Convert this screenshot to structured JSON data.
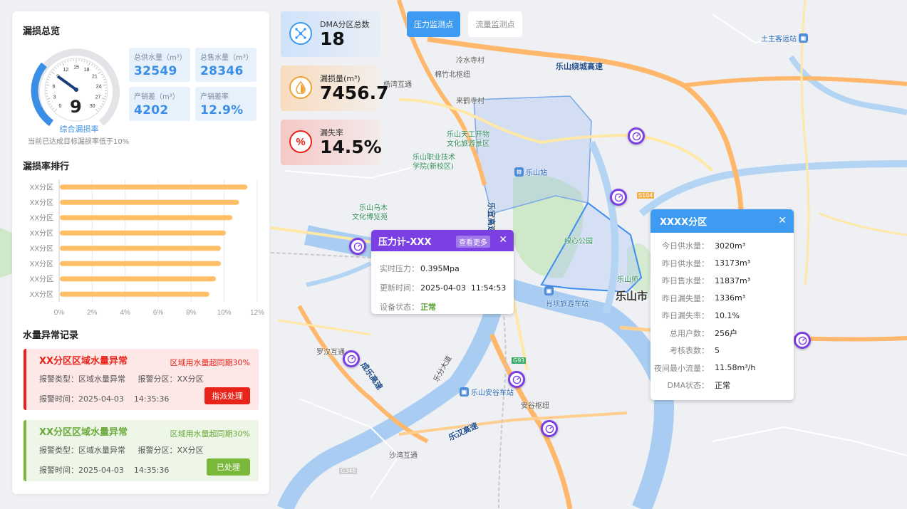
{
  "overview": {
    "title": "漏损总览",
    "gauge_value": "9",
    "gauge_ticks": [
      "0",
      "3",
      "6",
      "9",
      "12",
      "15",
      "18",
      "21",
      "24",
      "27",
      "30"
    ],
    "gauge_caption": "综合漏损率",
    "gauge_note": "当前已达成目标漏损率低于10%",
    "stats": [
      {
        "label": "总供水量（m³）",
        "value": "32549"
      },
      {
        "label": "总售水量（m³）",
        "value": "28346"
      },
      {
        "label": "产销差（m³）",
        "value": "4202"
      },
      {
        "label": "产销差率",
        "value": "12.9%"
      }
    ]
  },
  "ranking": {
    "title": "漏损率排行",
    "categories": [
      "XX分区",
      "XX分区",
      "XX分区",
      "XX分区",
      "XX分区",
      "XX分区",
      "XX分区",
      "XX分区"
    ],
    "x_ticks": [
      "0%",
      "2%",
      "4%",
      "6%",
      "8%",
      "10%",
      "12%"
    ]
  },
  "chart_data": {
    "type": "bar",
    "orientation": "horizontal",
    "categories": [
      "XX分区",
      "XX分区",
      "XX分区",
      "XX分区",
      "XX分区",
      "XX分区",
      "XX分区",
      "XX分区"
    ],
    "values": [
      11.4,
      10.9,
      10.5,
      10.1,
      9.8,
      9.8,
      9.5,
      9.1
    ],
    "xlim": [
      0,
      12
    ],
    "x_ticks": [
      "0%",
      "2%",
      "4%",
      "6%",
      "8%",
      "10%",
      "12%"
    ],
    "bar_color": "#ffbf66",
    "grid": true,
    "title": "漏损率排行"
  },
  "alerts": {
    "title": "水量异常记录",
    "items": [
      {
        "title": "XX分区区域水量异常",
        "tag": "区域用水量超同期30%",
        "type_label": "报警类型：",
        "type": "区域水量异常",
        "zone_label": "报警分区：",
        "zone": "XX分区",
        "time_label": "报警时间：",
        "time": "2025-04-03    14:35:36",
        "action": "指派处理",
        "status": "red"
      },
      {
        "title": "XX分区区域水量异常",
        "tag": "区域用水量超同期30%",
        "type_label": "报警类型：",
        "type": "区域水量异常",
        "zone_label": "报警分区：",
        "zone": "XX分区",
        "time_label": "报警时间：",
        "time": "2025-04-03    14:35:36",
        "action": "已处理",
        "status": "green"
      }
    ]
  },
  "kpis": [
    {
      "label": "DMA分区总数",
      "value": "18",
      "icon": "network-icon",
      "color": "#3d9bf2"
    },
    {
      "label": "漏损量(m³)",
      "value": "7456.7",
      "icon": "water-drop-icon",
      "color": "#f0a33a"
    },
    {
      "label": "漏失率",
      "value": "14.5%",
      "icon": "percent-icon",
      "color": "#e8231a"
    }
  ],
  "tabs": [
    {
      "label": "压力监测点",
      "active": true
    },
    {
      "label": "流量监测点",
      "active": false
    }
  ],
  "pressure_popup": {
    "title": "压力计-XXX",
    "more": "查看更多",
    "close": "✕",
    "rows": [
      {
        "label": "实时压力：",
        "value": "0.395Mpa"
      },
      {
        "label": "更新时间：",
        "value": "2025-04-03  11:54:53"
      },
      {
        "label": "设备状态：",
        "value": "正常"
      }
    ]
  },
  "zone_popup": {
    "title": "XXXX分区",
    "close": "✕",
    "rows": [
      {
        "label": "今日供水量：",
        "value": "3020m³"
      },
      {
        "label": "昨日供水量：",
        "value": "13173m³"
      },
      {
        "label": "昨日售水量：",
        "value": "11837m³"
      },
      {
        "label": "昨日漏失量：",
        "value": "1336m³"
      },
      {
        "label": "昨日漏失率：",
        "value": "10.1%"
      },
      {
        "label": "总用户数：",
        "value": "256户"
      },
      {
        "label": "考核表数：",
        "value": "5"
      },
      {
        "label": "夜间最小流量：",
        "value": "11.58m³/h"
      },
      {
        "label": "DMA状态：",
        "value": "正常"
      }
    ]
  },
  "map_labels": {
    "city": "乐山市",
    "ring_highway": "乐山绕城高速",
    "lengshui": "冷水寺村",
    "mianzhu": "棉竹北枢纽",
    "yangwan": "杨湾互通",
    "laixiao": "来鹤寺村",
    "tiangong": "乐山天工开物\n文化旅游景区",
    "vocational": "乐山职业技术\n学院(新校区)",
    "leshan_station": "乐山站",
    "wumu": "乐山乌木\n文化博览苑",
    "green_park": "绿心公园",
    "normal_univ": "乐山师",
    "xiao_ba": "肖坝旅游车站",
    "luohan": "罗汉互通",
    "anyu_station": "乐山安谷车站",
    "anyu_hub": "安谷枢纽",
    "shatu": "沙湾互通",
    "chengdu_road": "成乐高速",
    "leyi_road": "乐宜高速",
    "lejian_road": "乐汉高速",
    "tuzhu_station": "土主客运站",
    "g93": "G93",
    "g348": "G348",
    "s104": "S104",
    "lefen": "乐分大道"
  }
}
